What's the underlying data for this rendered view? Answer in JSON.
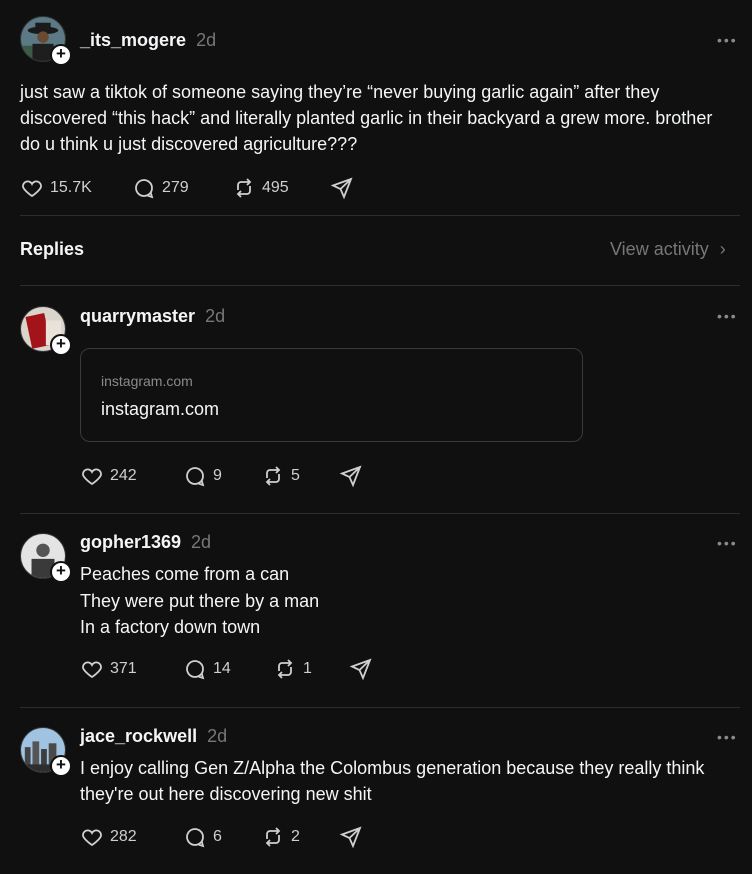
{
  "main_post": {
    "username": "_its_mogere",
    "time": "2d",
    "text": "just saw a tiktok of someone saying they’re “never buying garlic again” after they discovered “this hack” and literally planted garlic in their backyard a grew more. brother do u think u just discovered agriculture???",
    "likes": "15.7K",
    "comments": "279",
    "reposts": "495"
  },
  "replies_header": {
    "title": "Replies",
    "view_activity": "View activity"
  },
  "replies": [
    {
      "username": "quarrymaster",
      "time": "2d",
      "link_domain": "instagram.com",
      "link_title": "instagram.com",
      "likes": "242",
      "comments": "9",
      "reposts": "5"
    },
    {
      "username": "gopher1369",
      "time": "2d",
      "text": "Peaches come from a can\nThey were put there by a man\nIn a factory down town",
      "likes": "371",
      "comments": "14",
      "reposts": "1"
    },
    {
      "username": "jace_rockwell",
      "time": "2d",
      "text": "I enjoy calling Gen Z/Alpha the Colombus generation because they really think they're out here discovering new shit",
      "likes": "282",
      "comments": "6",
      "reposts": "2"
    }
  ],
  "icons": {
    "more": "•••",
    "plus": "+",
    "chevron": "›"
  },
  "colors": {
    "background": "#101010",
    "text": "#f3f5f7",
    "muted": "#777777",
    "divider": "#2d2d2d"
  }
}
